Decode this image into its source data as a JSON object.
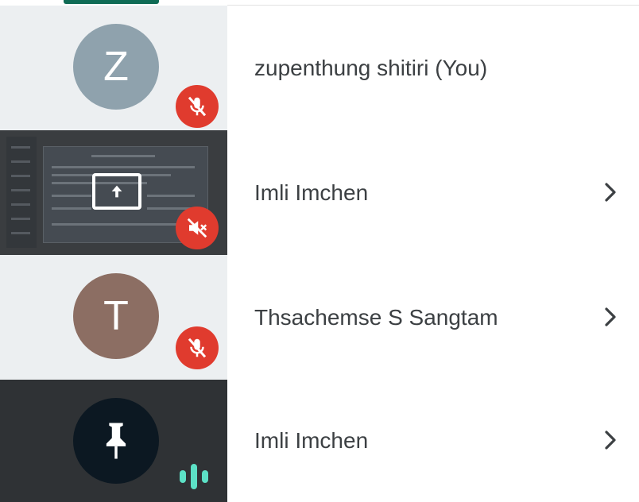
{
  "participants": [
    {
      "initial": "Z",
      "name": "zupenthung shitiri (You)",
      "status": "mic-off",
      "avatar_color": "#8fa2ad"
    },
    {
      "initial": "",
      "name": "Imli Imchen",
      "status": "audio-muted",
      "tile": "screen-share"
    },
    {
      "initial": "T",
      "name": "Thsachemse S Sangtam",
      "status": "mic-off",
      "avatar_color": "#8c6e63"
    },
    {
      "initial": "",
      "name": "Imli Imchen",
      "status": "speaking",
      "avatar_color": "#0c1822"
    }
  ],
  "colors": {
    "accent": "#0f6b55",
    "mute_badge": "#e03b2e",
    "speaking": "#5ce1c6"
  },
  "icons": [
    "mic-off-icon",
    "volume-off-icon",
    "screen-share-icon",
    "pin-icon",
    "speaking-indicator-icon",
    "chevron-right-icon"
  ]
}
